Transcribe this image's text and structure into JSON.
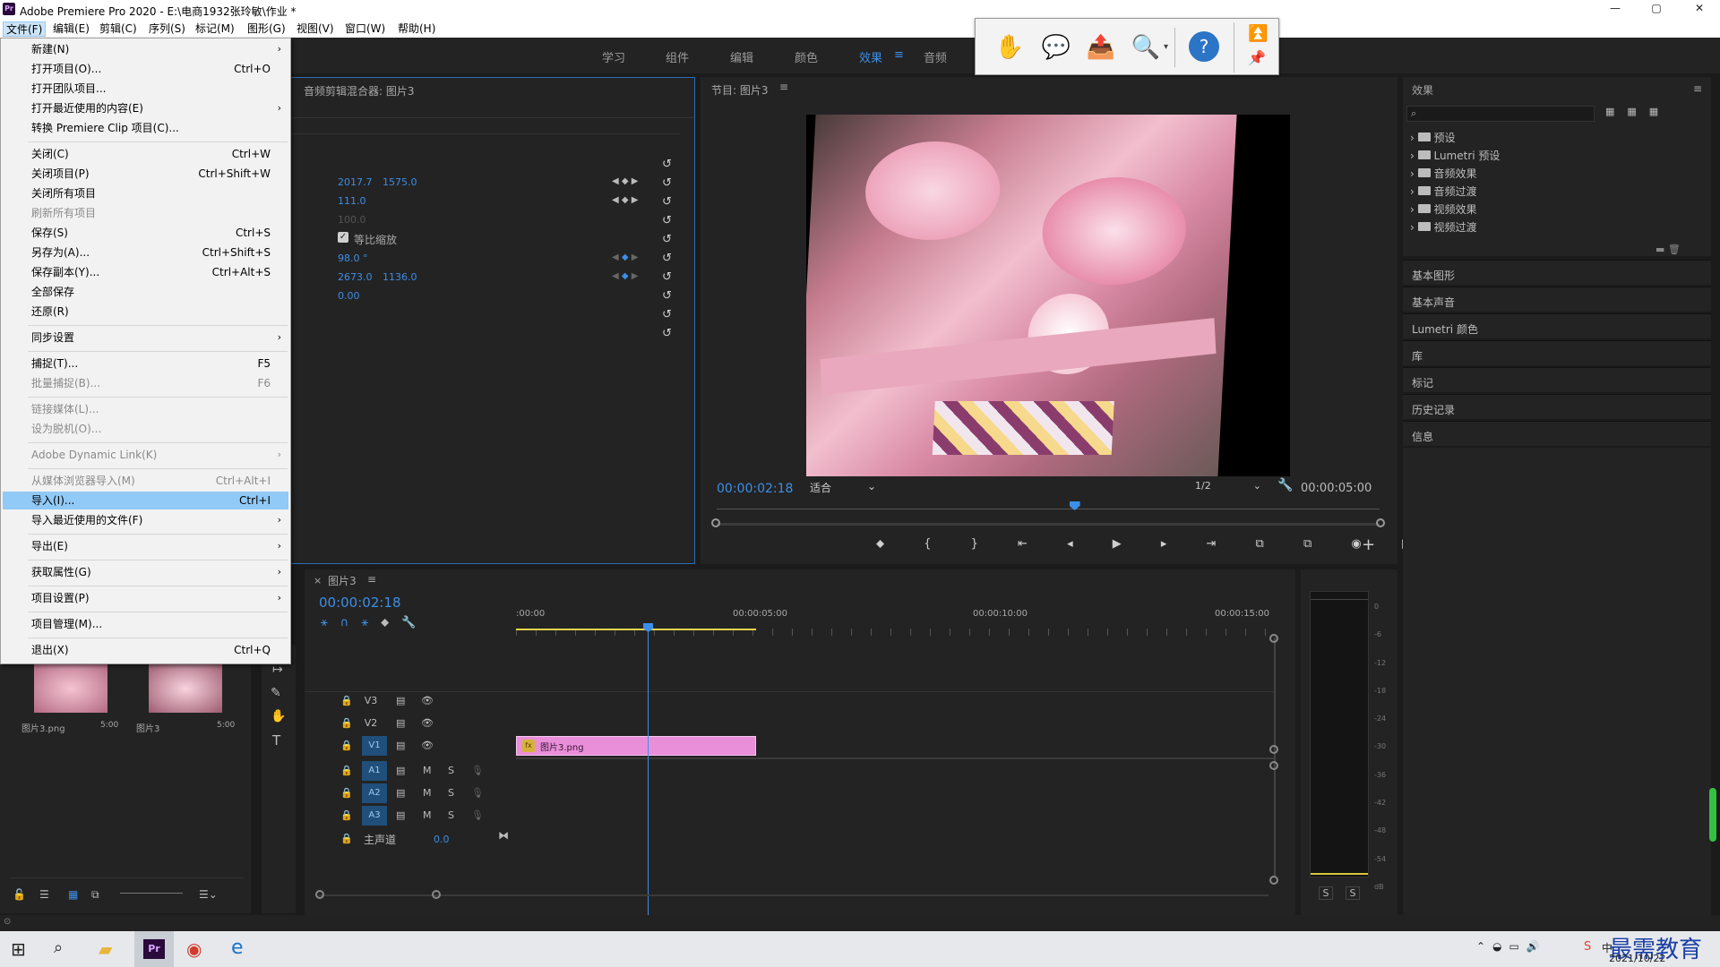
{
  "titlebar": {
    "logo": "Pr",
    "title": "Adobe Premiere Pro 2020 - E:\\电商1932张玲敏\\作业 *",
    "min": "—",
    "max": "▢",
    "close": "✕"
  },
  "menubar": [
    "文件(F)",
    "编辑(E)",
    "剪辑(C)",
    "序列(S)",
    "标记(M)",
    "图形(G)",
    "视图(V)",
    "窗口(W)",
    "帮助(H)"
  ],
  "workspaces": [
    {
      "label": "学习"
    },
    {
      "label": "组件"
    },
    {
      "label": "编辑"
    },
    {
      "label": "颜色"
    },
    {
      "label": "效果"
    },
    {
      "label": "音频"
    }
  ],
  "workspace_menu_glyph": "≡",
  "file_menu": [
    {
      "label": "新建(N)",
      "shortcut": "",
      "submenu": true
    },
    {
      "label": "打开项目(O)...",
      "shortcut": "Ctrl+O"
    },
    {
      "label": "打开团队项目...",
      "shortcut": ""
    },
    {
      "label": "打开最近使用的内容(E)",
      "shortcut": "",
      "submenu": true
    },
    {
      "label": "转换 Premiere Clip 项目(C)...",
      "shortcut": ""
    },
    {
      "label": "关闭(C)",
      "shortcut": "Ctrl+W"
    },
    {
      "label": "关闭项目(P)",
      "shortcut": "Ctrl+Shift+W"
    },
    {
      "label": "关闭所有项目",
      "shortcut": ""
    },
    {
      "label": "刷新所有项目",
      "shortcut": "",
      "disabled": true
    },
    {
      "label": "保存(S)",
      "shortcut": "Ctrl+S"
    },
    {
      "label": "另存为(A)...",
      "shortcut": "Ctrl+Shift+S"
    },
    {
      "label": "保存副本(Y)...",
      "shortcut": "Ctrl+Alt+S"
    },
    {
      "label": "全部保存",
      "shortcut": ""
    },
    {
      "label": "还原(R)",
      "shortcut": ""
    },
    {
      "label": "同步设置",
      "shortcut": "",
      "submenu": true
    },
    {
      "label": "捕捉(T)...",
      "shortcut": "F5"
    },
    {
      "label": "批量捕捉(B)...",
      "shortcut": "F6",
      "disabled": true
    },
    {
      "label": "链接媒体(L)...",
      "shortcut": "",
      "disabled": true
    },
    {
      "label": "设为脱机(O)...",
      "shortcut": "",
      "disabled": true
    },
    {
      "label": "Adobe Dynamic Link(K)",
      "shortcut": "",
      "submenu": true,
      "disabled": true
    },
    {
      "label": "从媒体浏览器导入(M)",
      "shortcut": "Ctrl+Alt+I",
      "disabled": true
    },
    {
      "label": "导入(I)...",
      "shortcut": "Ctrl+I",
      "highlighted": true
    },
    {
      "label": "导入最近使用的文件(F)",
      "shortcut": "",
      "submenu": true
    },
    {
      "label": "导出(E)",
      "shortcut": "",
      "submenu": true
    },
    {
      "label": "获取属性(G)",
      "shortcut": "",
      "submenu": true
    },
    {
      "label": "项目设置(P)",
      "shortcut": "",
      "submenu": true
    },
    {
      "label": "项目管理(M)...",
      "shortcut": ""
    },
    {
      "label": "退出(X)",
      "shortcut": "Ctrl+Q"
    }
  ],
  "effect_controls": {
    "tab_title": "音频剪辑混合器: 图片3",
    "position_x": "2017.7",
    "position_y": "1575.0",
    "scale": "111.0",
    "scale_width": "100.0",
    "uniform_scale": "等比缩放",
    "rotation": "98.0 °",
    "anchor_x": "2673.0",
    "anchor_y": "1136.0",
    "flicker": "0.00"
  },
  "program_monitor": {
    "title": "节目: 图片3",
    "timecode": "00:00:02:18",
    "fit": "适合",
    "quality": "1/2",
    "duration": "00:00:05:00",
    "playhead_fraction": 0.54
  },
  "effects_panel": {
    "title": "效果",
    "folders": [
      "预设",
      "Lumetri 预设",
      "音频效果",
      "音频过渡",
      "视频效果",
      "视频过渡"
    ],
    "collapsed_panels": [
      "基本图形",
      "基本声音",
      "Lumetri 颜色",
      "库",
      "标记",
      "历史记录",
      "信息"
    ]
  },
  "project_panel": {
    "items": [
      {
        "name": "图片3.png",
        "duration": "5:00"
      },
      {
        "name": "图片3",
        "duration": "5:00"
      }
    ]
  },
  "timeline": {
    "tab": "图片3",
    "timecode": "00:00:02:18",
    "ruler": [
      ":00:00",
      "00:00:05:00",
      "00:00:10:00",
      "00:00:15:00"
    ],
    "video_tracks": [
      "V3",
      "V2",
      "V1"
    ],
    "audio_tracks": [
      "A1",
      "A2",
      "A3"
    ],
    "master": "主声道",
    "master_value": "0.0",
    "clip_label": "图片3.png",
    "clip_fx": "fx",
    "m_label": "M",
    "s_label": "S"
  },
  "audio_meter": {
    "scale": [
      "0",
      "-6",
      "-12",
      "-18",
      "-24",
      "-30",
      "-36",
      "-42",
      "-48",
      "-54",
      "dB"
    ],
    "solo": [
      "S",
      "S"
    ]
  },
  "taskbar": {
    "time": "2021/10/22",
    "watermark": "最需教育",
    "ime": "中"
  },
  "colors": {
    "accent_blue": "#3d8ee6",
    "clip_pink": "#e98fd9",
    "playhead": "#3b8fe8",
    "menu_highlight": "#91c9f7"
  }
}
